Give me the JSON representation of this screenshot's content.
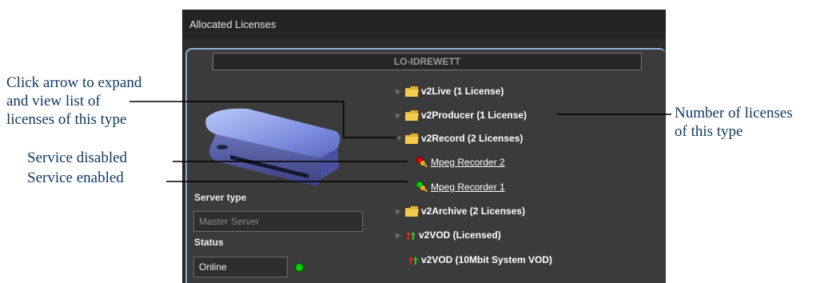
{
  "panel": {
    "title": "Allocated Licenses",
    "host_name": "LO-IDREWETT"
  },
  "server": {
    "type_label": "Server type",
    "type_value": "Master Server",
    "status_label": "Status",
    "status_value": "Online",
    "status_color": "#00d000"
  },
  "tree": {
    "v2live": "v2Live (1 License)",
    "v2producer": "v2Producer (1 License)",
    "v2record": "v2Record (2 Licenses)",
    "service_1": "Mpeg Recorder 2",
    "service_1_state": "disabled",
    "service_1_color": "#e00000",
    "service_2": "Mpeg Recorder 1",
    "service_2_state": "enabled",
    "service_2_color": "#00d000",
    "v2archive": "v2Archive (2 Licenses)",
    "v2vod": "v2VOD (Licensed)",
    "v2vod_system": "v2VOD (10Mbit System VOD)"
  },
  "callouts": {
    "expand_line1": "Click arrow to expand",
    "expand_line2": "and view list of",
    "expand_line3": "licenses of this type",
    "disabled": "Service disabled",
    "enabled": "Service enabled",
    "count_line1": "Number of licenses",
    "count_line2": "of this type"
  },
  "colors": {
    "callout_text": "#0e3a66",
    "leader_line": "#000000",
    "panel_border": "#8fb0d0"
  },
  "icons": [
    "chevron-right-icon",
    "chevron-down-icon",
    "folder-icon",
    "key-icon",
    "status-dot-icon",
    "vod-icon",
    "disk-drive-image"
  ]
}
